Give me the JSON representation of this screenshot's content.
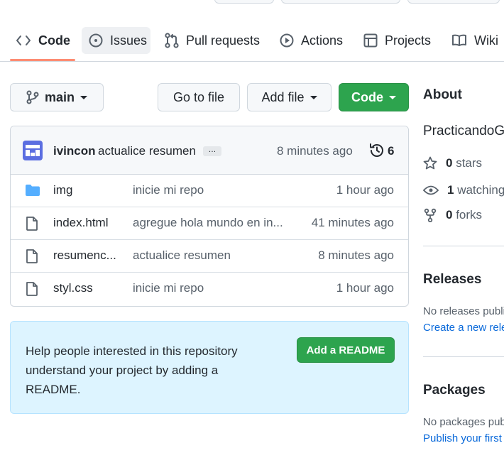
{
  "tabs": [
    {
      "label": "Code",
      "icon": "code-icon"
    },
    {
      "label": "Issues",
      "icon": "issue-opened-icon"
    },
    {
      "label": "Pull requests",
      "icon": "git-pull-request-icon"
    },
    {
      "label": "Actions",
      "icon": "play-icon"
    },
    {
      "label": "Projects",
      "icon": "table-icon"
    },
    {
      "label": "Wiki",
      "icon": "book-icon"
    }
  ],
  "toolbar": {
    "branch": "main",
    "go_to_file": "Go to file",
    "add_file": "Add file",
    "code": "Code"
  },
  "commit": {
    "author": "ivincon",
    "message": "actualice resumen",
    "ellipsis": "…",
    "time": "8 minutes ago",
    "history_count": "6"
  },
  "files": [
    {
      "name": "img",
      "type": "folder",
      "message": "inicie mi repo",
      "time": "1 hour ago"
    },
    {
      "name": "index.html",
      "type": "file",
      "message": "agregue hola mundo en in...",
      "time": "41 minutes ago"
    },
    {
      "name": "resumenc...",
      "type": "file",
      "message": "actualice resumen",
      "time": "8 minutes ago"
    },
    {
      "name": "styl.css",
      "type": "file",
      "message": "inicie mi repo",
      "time": "1 hour ago"
    }
  ],
  "readme": {
    "text": "Help people interested in this repository understand your project by adding a README.",
    "button": "Add a README"
  },
  "sidebar": {
    "about_title": "About",
    "repo_name": "PracticandoG",
    "stars_count": "0",
    "stars_label": "stars",
    "watching_count": "1",
    "watching_label": "watching",
    "forks_count": "0",
    "forks_label": "forks",
    "releases_title": "Releases",
    "releases_none": "No releases publi",
    "releases_link": "Create a new rele",
    "packages_title": "Packages",
    "packages_none": "No packages pub",
    "packages_link": "Publish your first"
  },
  "colors": {
    "accent_green": "#2da44e",
    "link_blue": "#0969da",
    "tab_underline": "#fd8c73",
    "folder_blue": "#54aeff",
    "readme_bg": "#ddf4ff"
  }
}
